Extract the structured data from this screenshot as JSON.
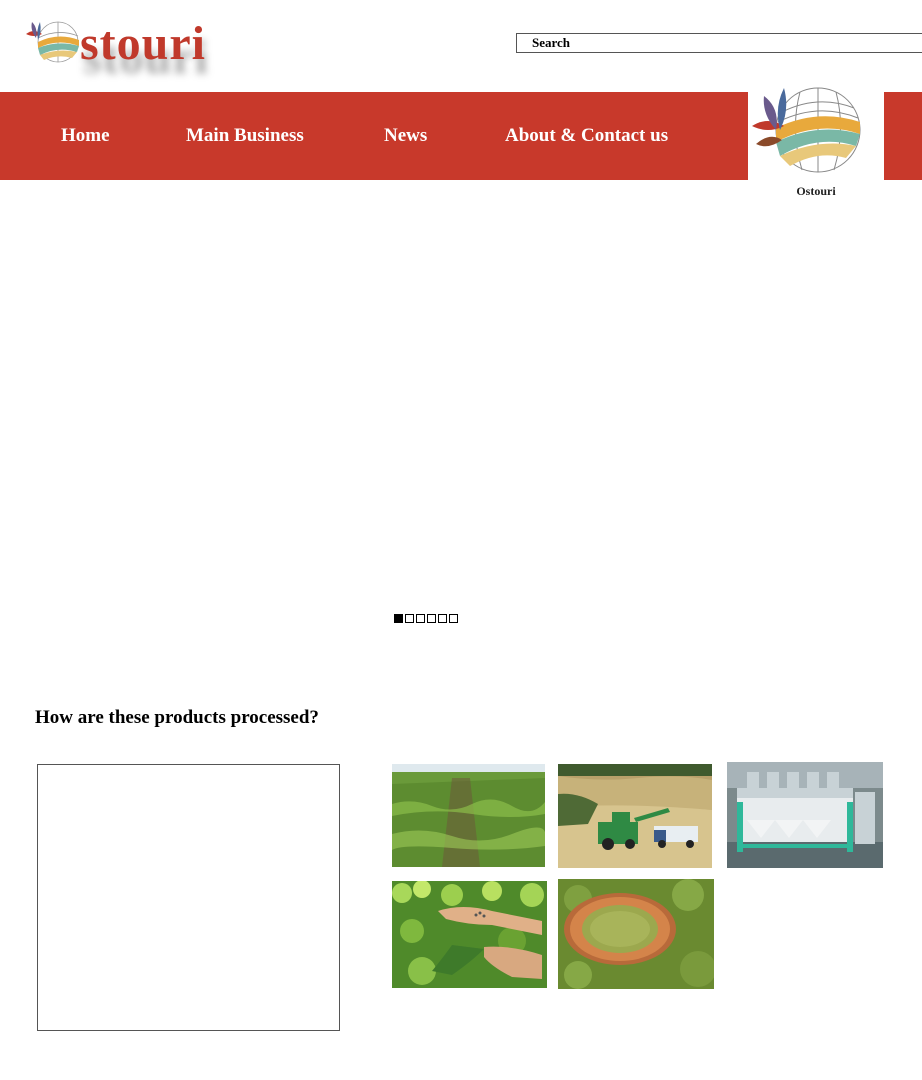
{
  "header": {
    "logo_text": "stouri",
    "search": {
      "placeholder": "Search"
    }
  },
  "nav": {
    "items": [
      {
        "label": "Home"
      },
      {
        "label": "Main Business"
      },
      {
        "label": "News"
      },
      {
        "label": "About & Contact us"
      }
    ],
    "brand_name": "Ostouri",
    "color": "#c8392b"
  },
  "slider": {
    "total_slides": 6,
    "active_index": 0
  },
  "section": {
    "title": "How are these products processed?",
    "photos": [
      {
        "subject": "green crop field"
      },
      {
        "subject": "combine harvester unloading grain"
      },
      {
        "subject": "color sorter machine"
      },
      {
        "subject": "hands holding seeds over plants"
      },
      {
        "subject": "bowl of dried green peas"
      }
    ]
  }
}
